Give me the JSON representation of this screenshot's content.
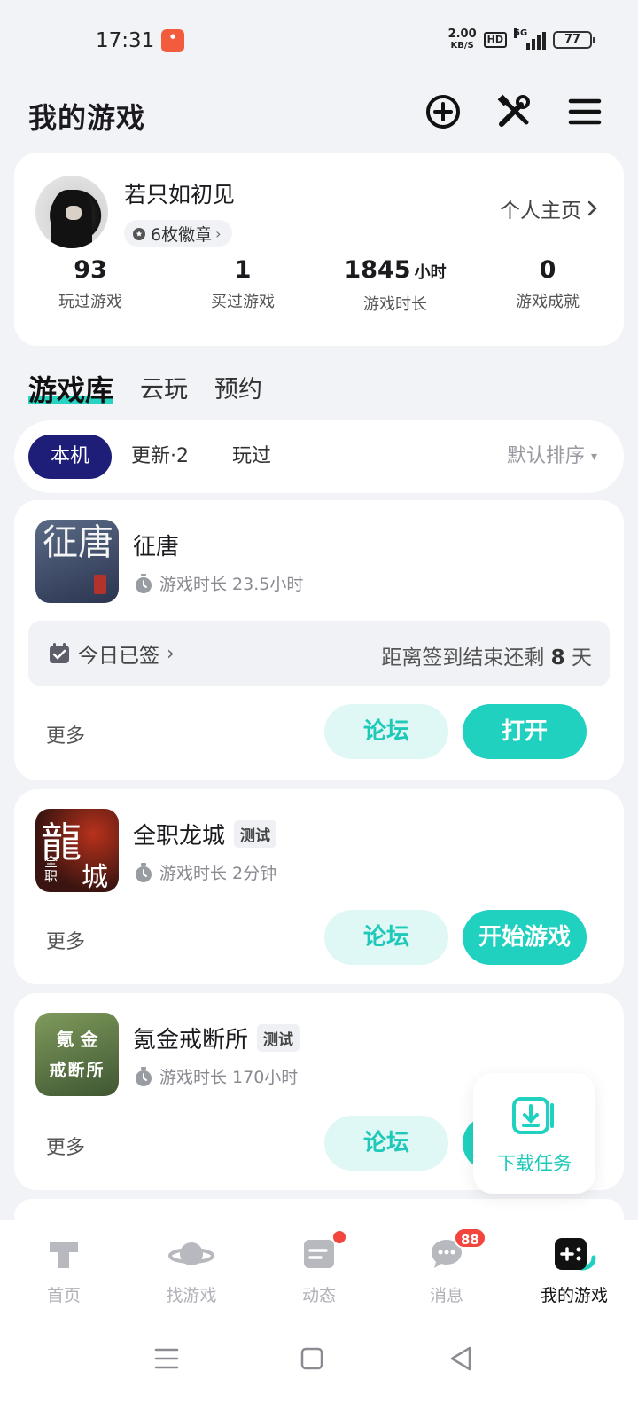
{
  "status_bar": {
    "time": "17:31",
    "net_speed_value": "2.00",
    "net_speed_unit": "KB/S",
    "hd": "HD",
    "network": "5G",
    "battery": "77"
  },
  "header": {
    "title": "我的游戏"
  },
  "profile": {
    "username": "若只如初见",
    "badges_label": "6枚徽章",
    "homepage_label": "个人主页",
    "stats": [
      {
        "value": "93",
        "unit": "",
        "label": "玩过游戏"
      },
      {
        "value": "1",
        "unit": "",
        "label": "买过游戏"
      },
      {
        "value": "1845",
        "unit": "小时",
        "label": "游戏时长"
      },
      {
        "value": "0",
        "unit": "",
        "label": "游戏成就"
      }
    ]
  },
  "main_tabs": [
    {
      "label": "游戏库",
      "active": true
    },
    {
      "label": "云玩",
      "active": false
    },
    {
      "label": "预约",
      "active": false
    }
  ],
  "filters": {
    "chips": [
      "本机",
      "更新·2",
      "玩过"
    ],
    "active_chip": "本机",
    "sort_label": "默认排序"
  },
  "games": [
    {
      "name": "征唐",
      "tag": "",
      "playtime": "游戏时长 23.5小时",
      "icon_text": "征唐",
      "signin_status": "今日已签",
      "signin_remaining_prefix": "距离签到结束还剩",
      "signin_remaining_days": "8",
      "signin_remaining_suffix": "天",
      "more_label": "更多",
      "forum_label": "论坛",
      "primary_label": "打开"
    },
    {
      "name": "全职龙城",
      "tag": "测试",
      "playtime": "游戏时长 2分钟",
      "icon_text": "龍",
      "icon_sub": "全职",
      "icon_sub2": "城",
      "more_label": "更多",
      "forum_label": "论坛",
      "primary_label": "开始游戏"
    },
    {
      "name": "氪金戒断所",
      "tag": "测试",
      "playtime": "游戏时长 170小时",
      "icon_line1": "氪 金",
      "icon_line2": "戒断所",
      "more_label": "更多",
      "forum_label": "论坛",
      "primary_label": ""
    }
  ],
  "download_fab": {
    "label": "下载任务"
  },
  "bottom_nav": [
    {
      "label": "首页",
      "icon": "home-icon",
      "active": false
    },
    {
      "label": "找游戏",
      "icon": "planet-icon",
      "active": false
    },
    {
      "label": "动态",
      "icon": "feed-icon",
      "active": false,
      "dot": true
    },
    {
      "label": "消息",
      "icon": "message-icon",
      "active": false,
      "badge": "88"
    },
    {
      "label": "我的游戏",
      "icon": "gamepad-icon",
      "active": true
    }
  ],
  "colors": {
    "accent": "#20d1bf",
    "navy": "#1e1e78",
    "badge_red": "#f2453d"
  }
}
